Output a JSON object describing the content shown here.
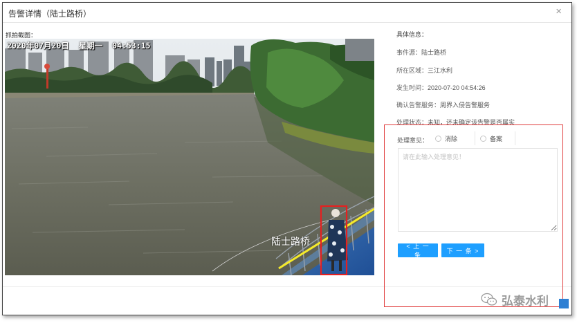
{
  "dialog": {
    "title": "告警详情（陆士路桥）",
    "close_symbol": "×"
  },
  "snapshot": {
    "label": "抓拍截图：",
    "osd_text": "2020年07月20日  星期一  04:53:15",
    "road_label": "陆士路桥"
  },
  "info": {
    "header": "具体信息：",
    "rows": [
      {
        "key": "事件源：",
        "value": "陆士路桥"
      },
      {
        "key": "所在区域：",
        "value": "三江水利"
      },
      {
        "key": "发生时间：",
        "value": "2020-07-20 04:54:26"
      },
      {
        "key": "确认告警服务：",
        "value": "周界入侵告警服务"
      },
      {
        "key": "处理状态：",
        "value": "未知，还未确定该告警是否属实"
      }
    ]
  },
  "handling": {
    "label": "处理意见：",
    "options": [
      "消除",
      "备案"
    ],
    "remark_placeholder": "请在此输入处理意见！",
    "prev_label": "< 上 一 条",
    "next_label": "下 一 条 >"
  },
  "watermark": {
    "text": "弘泰水利"
  },
  "colors": {
    "accent": "#1e9fff",
    "highlight_box": "#e03a3a",
    "intrusion_line": "#f5ea2a"
  }
}
